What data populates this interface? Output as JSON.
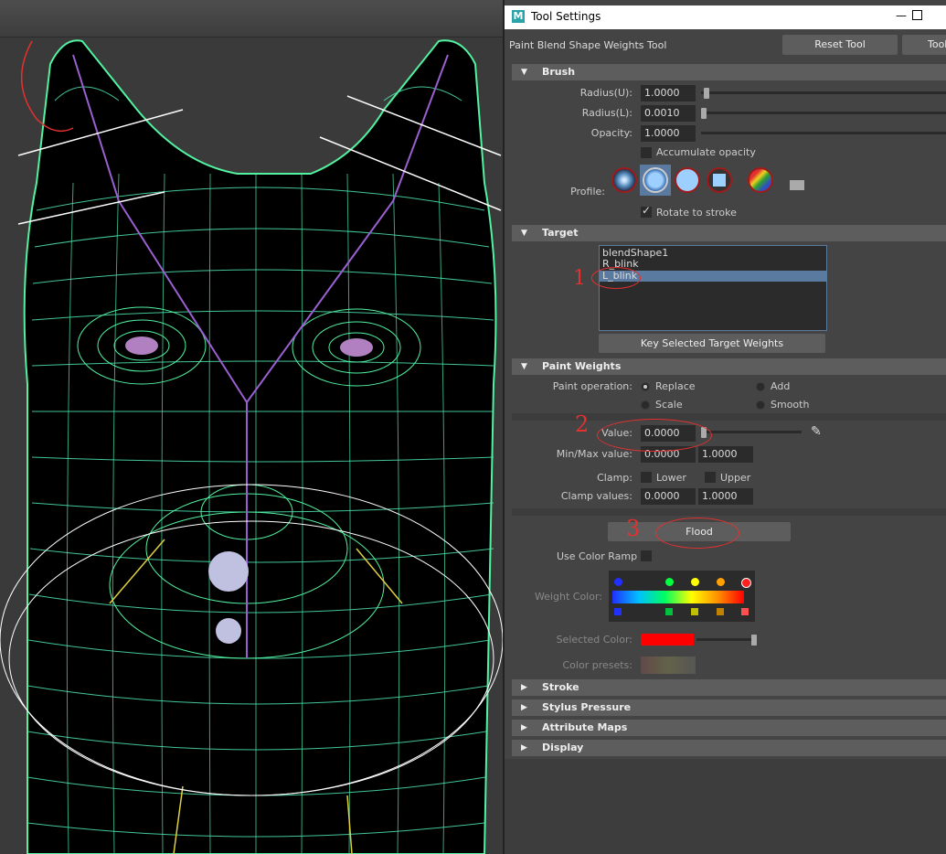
{
  "window": {
    "title": "Tool Settings",
    "logo": "M"
  },
  "tool": {
    "name": "Paint Blend Shape Weights Tool",
    "reset_label": "Reset Tool",
    "tool_label": "Tool"
  },
  "brush": {
    "header": "Brush",
    "radius_u": {
      "label": "Radius(U):",
      "value": "1.0000",
      "level": 0.01
    },
    "radius_l": {
      "label": "Radius(L):",
      "value": "0.0010",
      "level": 0.0
    },
    "opacity": {
      "label": "Opacity:",
      "value": "1.0000",
      "level": 1.0
    },
    "accumulate_label": "Accumulate opacity",
    "profile_label": "Profile:",
    "rotate_label": "Rotate to stroke"
  },
  "target": {
    "header": "Target",
    "items": [
      "blendShape1",
      "R_blink",
      "L_blink"
    ],
    "selected": "L_blink",
    "key_button": "Key Selected Target Weights"
  },
  "paint_weights": {
    "header": "Paint Weights",
    "operation_label": "Paint operation:",
    "ops": [
      "Replace",
      "Add",
      "Scale",
      "Smooth"
    ],
    "selected_op": "Replace",
    "value_label": "Value:",
    "value": "0.0000",
    "minmax_label": "Min/Max value:",
    "min": "0.0000",
    "max": "1.0000",
    "clamp_label": "Clamp:",
    "lower_label": "Lower",
    "upper_label": "Upper",
    "clamp_values_label": "Clamp values:",
    "clamp_min": "0.0000",
    "clamp_max": "1.0000",
    "flood_label": "Flood",
    "color_ramp_label": "Use Color Ramp",
    "weight_color_label": "Weight Color:",
    "selected_color_label": "Selected Color:",
    "color_presets_label": "Color presets:",
    "selected_color": "#ff0000"
  },
  "collapsed_sections": [
    "Stroke",
    "Stylus Pressure",
    "Attribute Maps",
    "Display"
  ],
  "annotations": [
    "1",
    "2",
    "3"
  ],
  "colors": {
    "accent": "#5a7aa0",
    "wire_green": "#52f2a0",
    "annotation_red": "#e53030"
  }
}
